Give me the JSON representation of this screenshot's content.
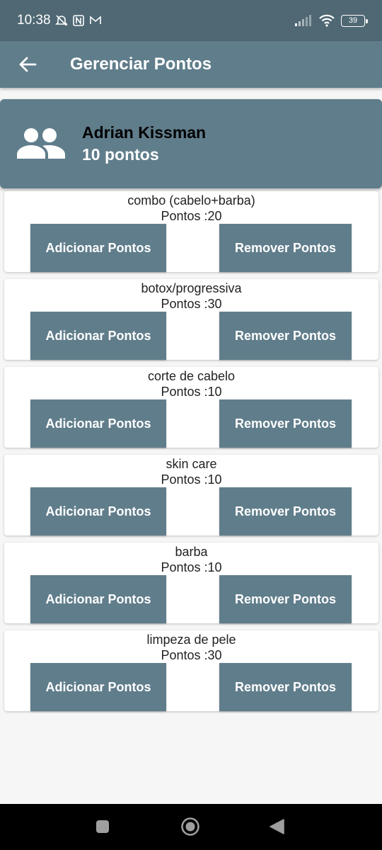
{
  "status_bar": {
    "time": "10:38",
    "battery": "39"
  },
  "app_bar": {
    "title": "Gerenciar Pontos"
  },
  "user": {
    "name": "Adrian Kissman",
    "points": "10 pontos"
  },
  "services": [
    {
      "name": "combo (cabelo+barba)",
      "points": "Pontos :20",
      "add_label": "Adicionar Pontos",
      "remove_label": "Remover Pontos"
    },
    {
      "name": "botox/progressiva",
      "points": "Pontos :30",
      "add_label": "Adicionar Pontos",
      "remove_label": "Remover Pontos"
    },
    {
      "name": "corte de cabelo",
      "points": "Pontos :10",
      "add_label": "Adicionar Pontos",
      "remove_label": "Remover Pontos"
    },
    {
      "name": "skin care",
      "points": "Pontos :10",
      "add_label": "Adicionar Pontos",
      "remove_label": "Remover Pontos"
    },
    {
      "name": "barba",
      "points": "Pontos :10",
      "add_label": "Adicionar Pontos",
      "remove_label": "Remover Pontos"
    },
    {
      "name": "limpeza de pele",
      "points": "Pontos :30",
      "add_label": "Adicionar Pontos",
      "remove_label": "Remover Pontos"
    }
  ],
  "colors": {
    "primary": "#607d8b",
    "status_bar": "#4f6874",
    "background": "#f6f6f6"
  },
  "icons": {
    "back": "arrow-left-icon",
    "user": "group-icon",
    "nav_recents": "square-icon",
    "nav_home": "circle-icon",
    "nav_back": "triangle-icon"
  }
}
